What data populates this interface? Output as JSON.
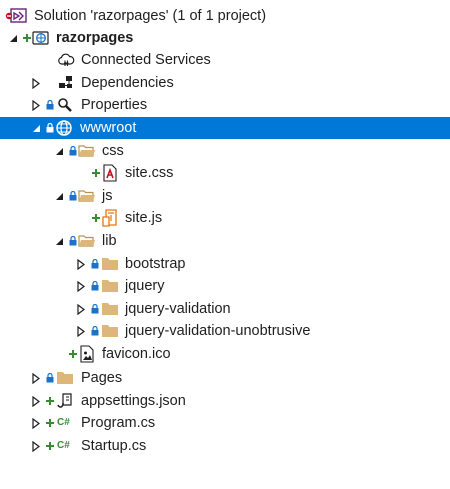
{
  "colors": {
    "selection": "#0078d7",
    "folder": "#dcb67a",
    "add": "#388a34",
    "lock": "#1a73c8",
    "csharp": "#388a34",
    "json": "#444444"
  },
  "solution": {
    "label": "Solution 'razorpages' (1 of 1 project)"
  },
  "project": {
    "label": "razorpages"
  },
  "items": {
    "connected_services": "Connected Services",
    "dependencies": "Dependencies",
    "properties": "Properties",
    "wwwroot": "wwwroot",
    "css": "css",
    "site_css": "site.css",
    "js": "js",
    "site_js": "site.js",
    "lib": "lib",
    "bootstrap": "bootstrap",
    "jquery": "jquery",
    "jquery_validation": "jquery-validation",
    "jquery_validation_unobtrusive": "jquery-validation-unobtrusive",
    "favicon": "favicon.ico",
    "pages": "Pages",
    "appsettings": "appsettings.json",
    "program": "Program.cs",
    "startup": "Startup.cs"
  },
  "icons": {
    "csharp_glyph": "C#"
  }
}
